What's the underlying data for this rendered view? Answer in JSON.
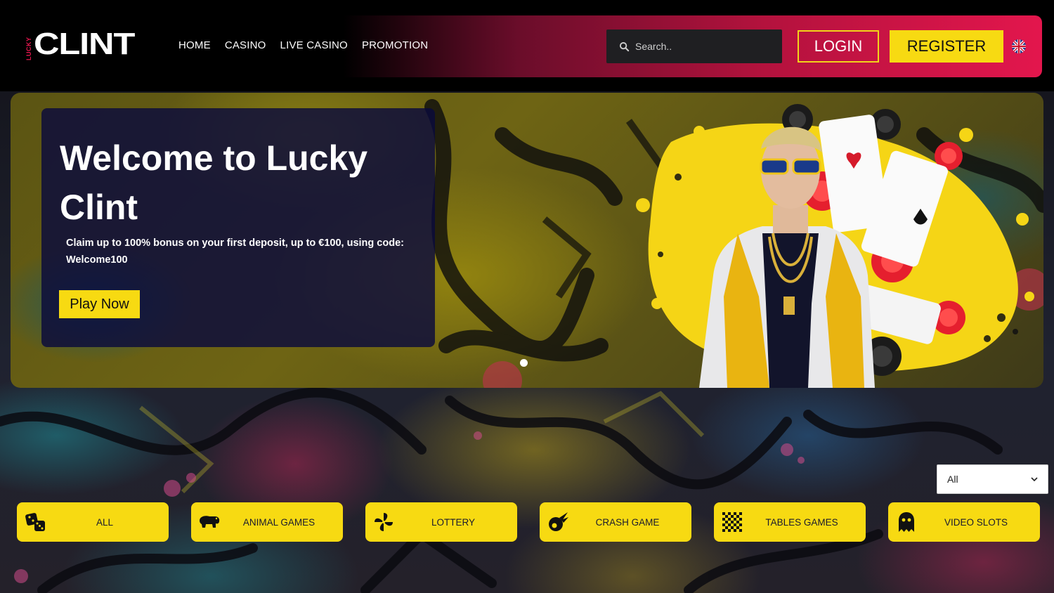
{
  "header": {
    "logo_small": "LUCKY",
    "logo_main": "CLINT",
    "nav": [
      "HOME",
      "CASINO",
      "LIVE CASINO",
      "PROMOTION"
    ],
    "search_placeholder": "Search..",
    "login": "LOGIN",
    "register": "REGISTER",
    "language_icon": "uk-flag-icon"
  },
  "hero": {
    "title": "Welcome to Lucky Clint",
    "text": "Claim up to 100% bonus on your first deposit, up to €100, using code: Welcome100",
    "cta": "Play Now",
    "slide_dots": 1
  },
  "filter": {
    "selected": "All"
  },
  "categories": [
    {
      "label": "ALL",
      "icon": "dice-icon"
    },
    {
      "label": "ANIMAL GAMES",
      "icon": "hippo-icon"
    },
    {
      "label": "LOTTERY",
      "icon": "pinwheel-icon"
    },
    {
      "label": "CRASH GAME",
      "icon": "meteor-icon"
    },
    {
      "label": "TABLES GAMES",
      "icon": "checkerboard-icon"
    },
    {
      "label": "VIDEO SLOTS",
      "icon": "ghost-icon"
    }
  ],
  "colors": {
    "accent_yellow": "#f7da12",
    "accent_red": "#e3164d",
    "header_bg": "#000000"
  }
}
